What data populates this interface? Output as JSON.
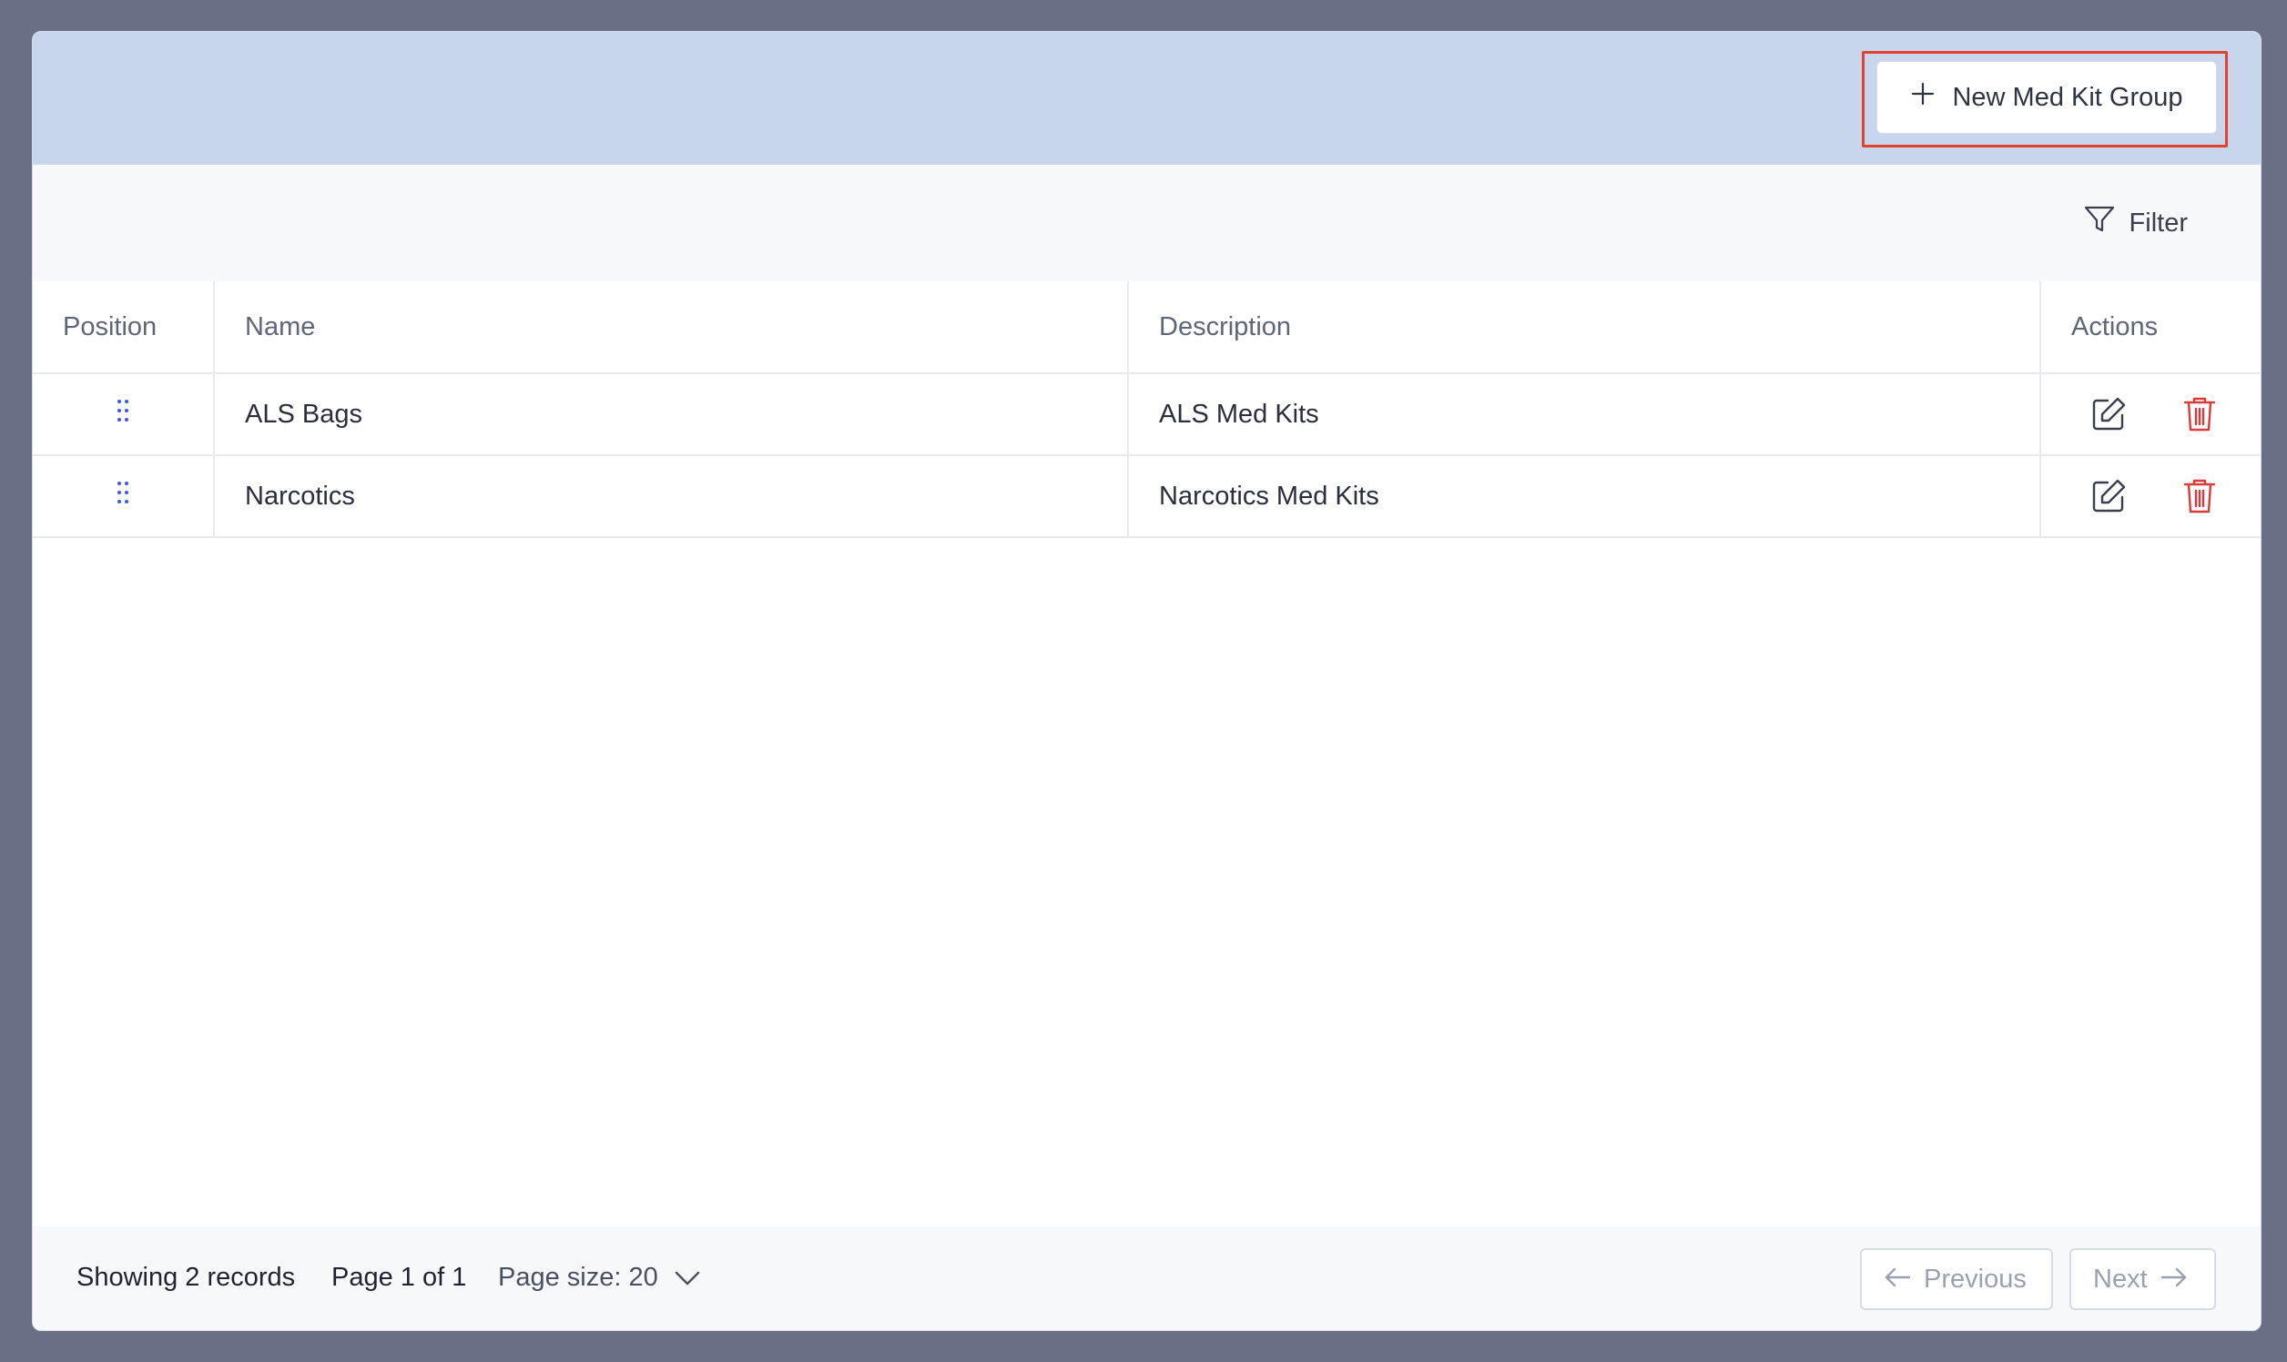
{
  "header": {
    "new_button_label": "New Med Kit Group",
    "new_button_icon": "plus-icon"
  },
  "toolbar": {
    "filter_label": "Filter",
    "filter_icon": "filter-icon"
  },
  "table": {
    "columns": [
      "Position",
      "Name",
      "Description",
      "Actions"
    ],
    "rows": [
      {
        "name": "ALS Bags",
        "description": "ALS Med Kits"
      },
      {
        "name": "Narcotics",
        "description": "Narcotics Med Kits"
      }
    ]
  },
  "footer": {
    "records_text": "Showing 2 records",
    "page_text": "Page 1 of 1",
    "page_size_text": "Page size: 20",
    "previous_label": "Previous",
    "next_label": "Next"
  },
  "colors": {
    "header_bg": "#c8d6ed",
    "highlight_border": "#e2412e",
    "delete_icon": "#d93a3a",
    "grip_icon": "#3b5bdb"
  }
}
